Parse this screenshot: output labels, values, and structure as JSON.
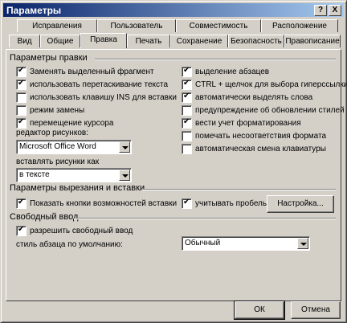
{
  "window": {
    "title": "Параметры",
    "help_label": "?",
    "close_label": "X"
  },
  "tabs_back": [
    "Исправления",
    "Пользователь",
    "Совместимость",
    "Расположение"
  ],
  "tabs_front": [
    "Вид",
    "Общие",
    "Правка",
    "Печать",
    "Сохранение",
    "Безопасность",
    "Правописание"
  ],
  "active_tab": "Правка",
  "edit_section": {
    "title": "Параметры правки",
    "left_checks": [
      {
        "label": "Заменять выделенный фрагмент",
        "checked": true
      },
      {
        "label": "использовать перетаскивание текста",
        "checked": true
      },
      {
        "label": "использовать клавишу INS для вставки",
        "checked": false
      },
      {
        "label": "режим замены",
        "checked": false
      },
      {
        "label": "перемещение курсора",
        "checked": true
      }
    ],
    "right_checks": [
      {
        "label": "выделение абзацев",
        "checked": true
      },
      {
        "label": "CTRL + щелчок для выбора гиперссылки",
        "checked": true
      },
      {
        "label": "автоматически выделять слова",
        "checked": true
      },
      {
        "label": "предупреждение об обновлении стилей",
        "checked": false
      },
      {
        "label": "вести учет форматирования",
        "checked": true
      },
      {
        "label": "помечать несоответствия формата",
        "checked": false
      },
      {
        "label": "автоматическая смена клавиатуры",
        "checked": false
      }
    ],
    "picture_editor_label": "редактор рисунков:",
    "picture_editor_value": "Microsoft Office Word",
    "insert_as_label": "вставлять рисунки как",
    "insert_as_value": "в тексте"
  },
  "cut_section": {
    "title": "Параметры вырезания и вставки",
    "show_paste_buttons": {
      "label": "Показать кнопки возможностей вставки",
      "checked": true
    },
    "smart_spaces": {
      "label": "учитывать пробелы",
      "checked": true
    },
    "settings_button": "Настройка..."
  },
  "click_section": {
    "title": "Свободный ввод",
    "enable": {
      "label": "разрешить свободный ввод",
      "checked": true
    },
    "style_label": "стиль абзаца по умолчанию:",
    "style_value": "Обычный"
  },
  "footer": {
    "ok": "ОК",
    "cancel": "Отмена"
  }
}
